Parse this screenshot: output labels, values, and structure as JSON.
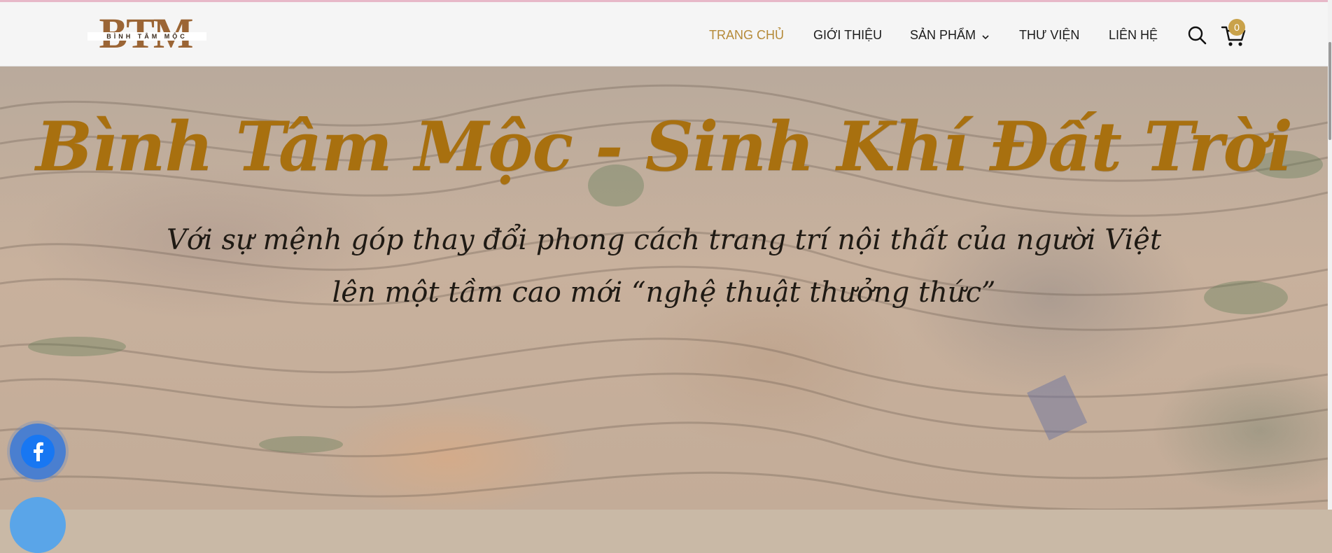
{
  "brand": {
    "logo_letters": "BTM",
    "logo_subtitle": "BÌNH TÂM MỘC",
    "logo_color": "#9b6535"
  },
  "nav": {
    "items": [
      {
        "label": "TRANG CHỦ",
        "active": true
      },
      {
        "label": "GIỚI THIỆU",
        "active": false
      },
      {
        "label": "SẢN PHẨM",
        "active": false,
        "has_dropdown": true
      },
      {
        "label": "THƯ VIỆN",
        "active": false
      },
      {
        "label": "LIÊN HỆ",
        "active": false
      }
    ],
    "active_color": "#b58a38",
    "search_icon": "search-icon",
    "cart_icon": "cart-icon",
    "cart_count": "0"
  },
  "hero": {
    "title": "Bình Tâm Mộc - Sinh Khí Đất Trời",
    "subtitle_line1": "Với sự mệnh góp thay đổi phong cách trang trí nội thất của người Việt",
    "subtitle_line2": "lên một tầm cao mới “nghệ thuật thưởng thức”",
    "title_color": "#a8700f",
    "background": "aerial view of rice terraces"
  },
  "floating": {
    "facebook_icon": "facebook-icon",
    "facebook_color": "#1877f2"
  }
}
